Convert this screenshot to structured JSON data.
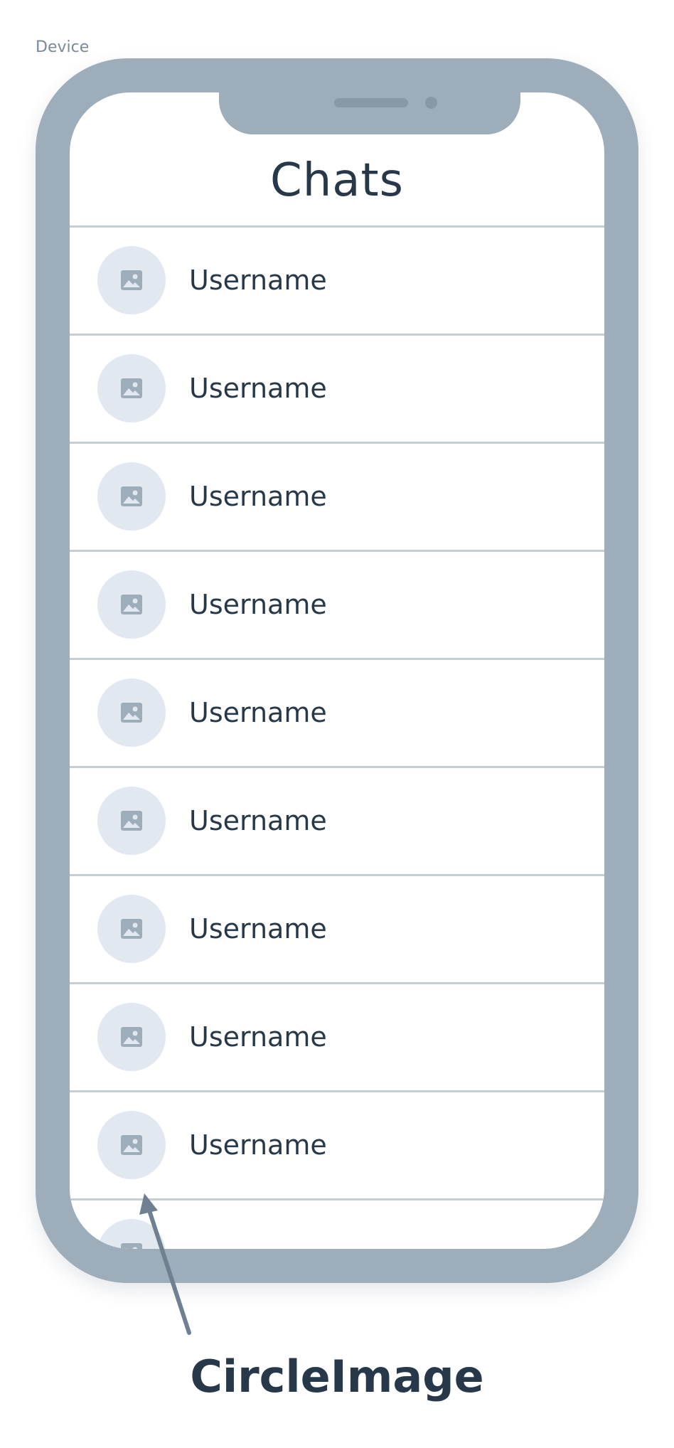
{
  "frame": {
    "label": "Device"
  },
  "screen": {
    "title": "Chats"
  },
  "chats": [
    {
      "username": "Username",
      "avatar_icon": "image-placeholder-icon"
    },
    {
      "username": "Username",
      "avatar_icon": "image-placeholder-icon"
    },
    {
      "username": "Username",
      "avatar_icon": "image-placeholder-icon"
    },
    {
      "username": "Username",
      "avatar_icon": "image-placeholder-icon"
    },
    {
      "username": "Username",
      "avatar_icon": "image-placeholder-icon"
    },
    {
      "username": "Username",
      "avatar_icon": "image-placeholder-icon"
    },
    {
      "username": "Username",
      "avatar_icon": "image-placeholder-icon"
    },
    {
      "username": "Username",
      "avatar_icon": "image-placeholder-icon"
    },
    {
      "username": "Username",
      "avatar_icon": "image-placeholder-icon"
    },
    {
      "username": "",
      "avatar_icon": "image-placeholder-icon"
    }
  ],
  "annotation": {
    "caption": "CircleImage"
  },
  "colors": {
    "device_frame": "#9dadba",
    "text": "#27384a",
    "divider": "#c3ced9",
    "avatar_background": "#e2e8ef",
    "avatar_icon": "#9dadba"
  }
}
